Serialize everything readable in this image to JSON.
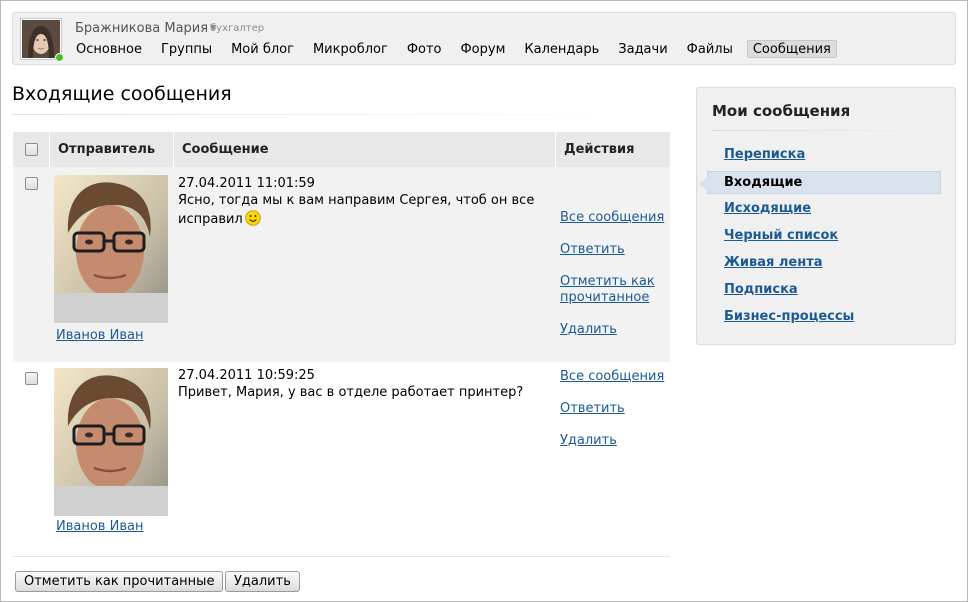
{
  "user": {
    "name": "Бражникова Мария",
    "role": "бухгалтер",
    "status_color": "#3fbf2a"
  },
  "nav": {
    "items": [
      "Основное",
      "Группы",
      "Мой блог",
      "Микроблог",
      "Фото",
      "Форум",
      "Календарь",
      "Задачи",
      "Файлы",
      "Сообщения"
    ],
    "active": "Сообщения"
  },
  "page": {
    "title": "Входящие сообщения"
  },
  "table": {
    "headers": {
      "sender": "Отправитель",
      "message": "Сообщение",
      "actions": "Действия"
    },
    "rows": [
      {
        "sender": "Иванов Иван",
        "date": "27.04.2011 11:01:59",
        "text": "Ясно, тогда мы к вам направим Сергея, чтоб он все исправил",
        "has_smiley": true,
        "actions": [
          "Все сообщения",
          "Ответить",
          "Отметить как прочитанное",
          "Удалить"
        ]
      },
      {
        "sender": "Иванов Иван",
        "date": "27.04.2011 10:59:25",
        "text": "Привет, Мария, у вас в отделе работает принтер?",
        "has_smiley": false,
        "actions": [
          "Все сообщения",
          "Ответить",
          "Удалить"
        ]
      }
    ]
  },
  "buttons": {
    "mark_read": "Отметить как прочитанные",
    "delete": "Удалить"
  },
  "sidebar": {
    "title": "Мои сообщения",
    "items": [
      "Переписка",
      "Входящие",
      "Исходящие",
      "Черный список",
      "Живая лента",
      "Подписка",
      "Бизнес-процессы"
    ],
    "active": "Входящие"
  },
  "colors": {
    "link": "#1c5a94",
    "active_item_bg": "#d9e3ee"
  }
}
